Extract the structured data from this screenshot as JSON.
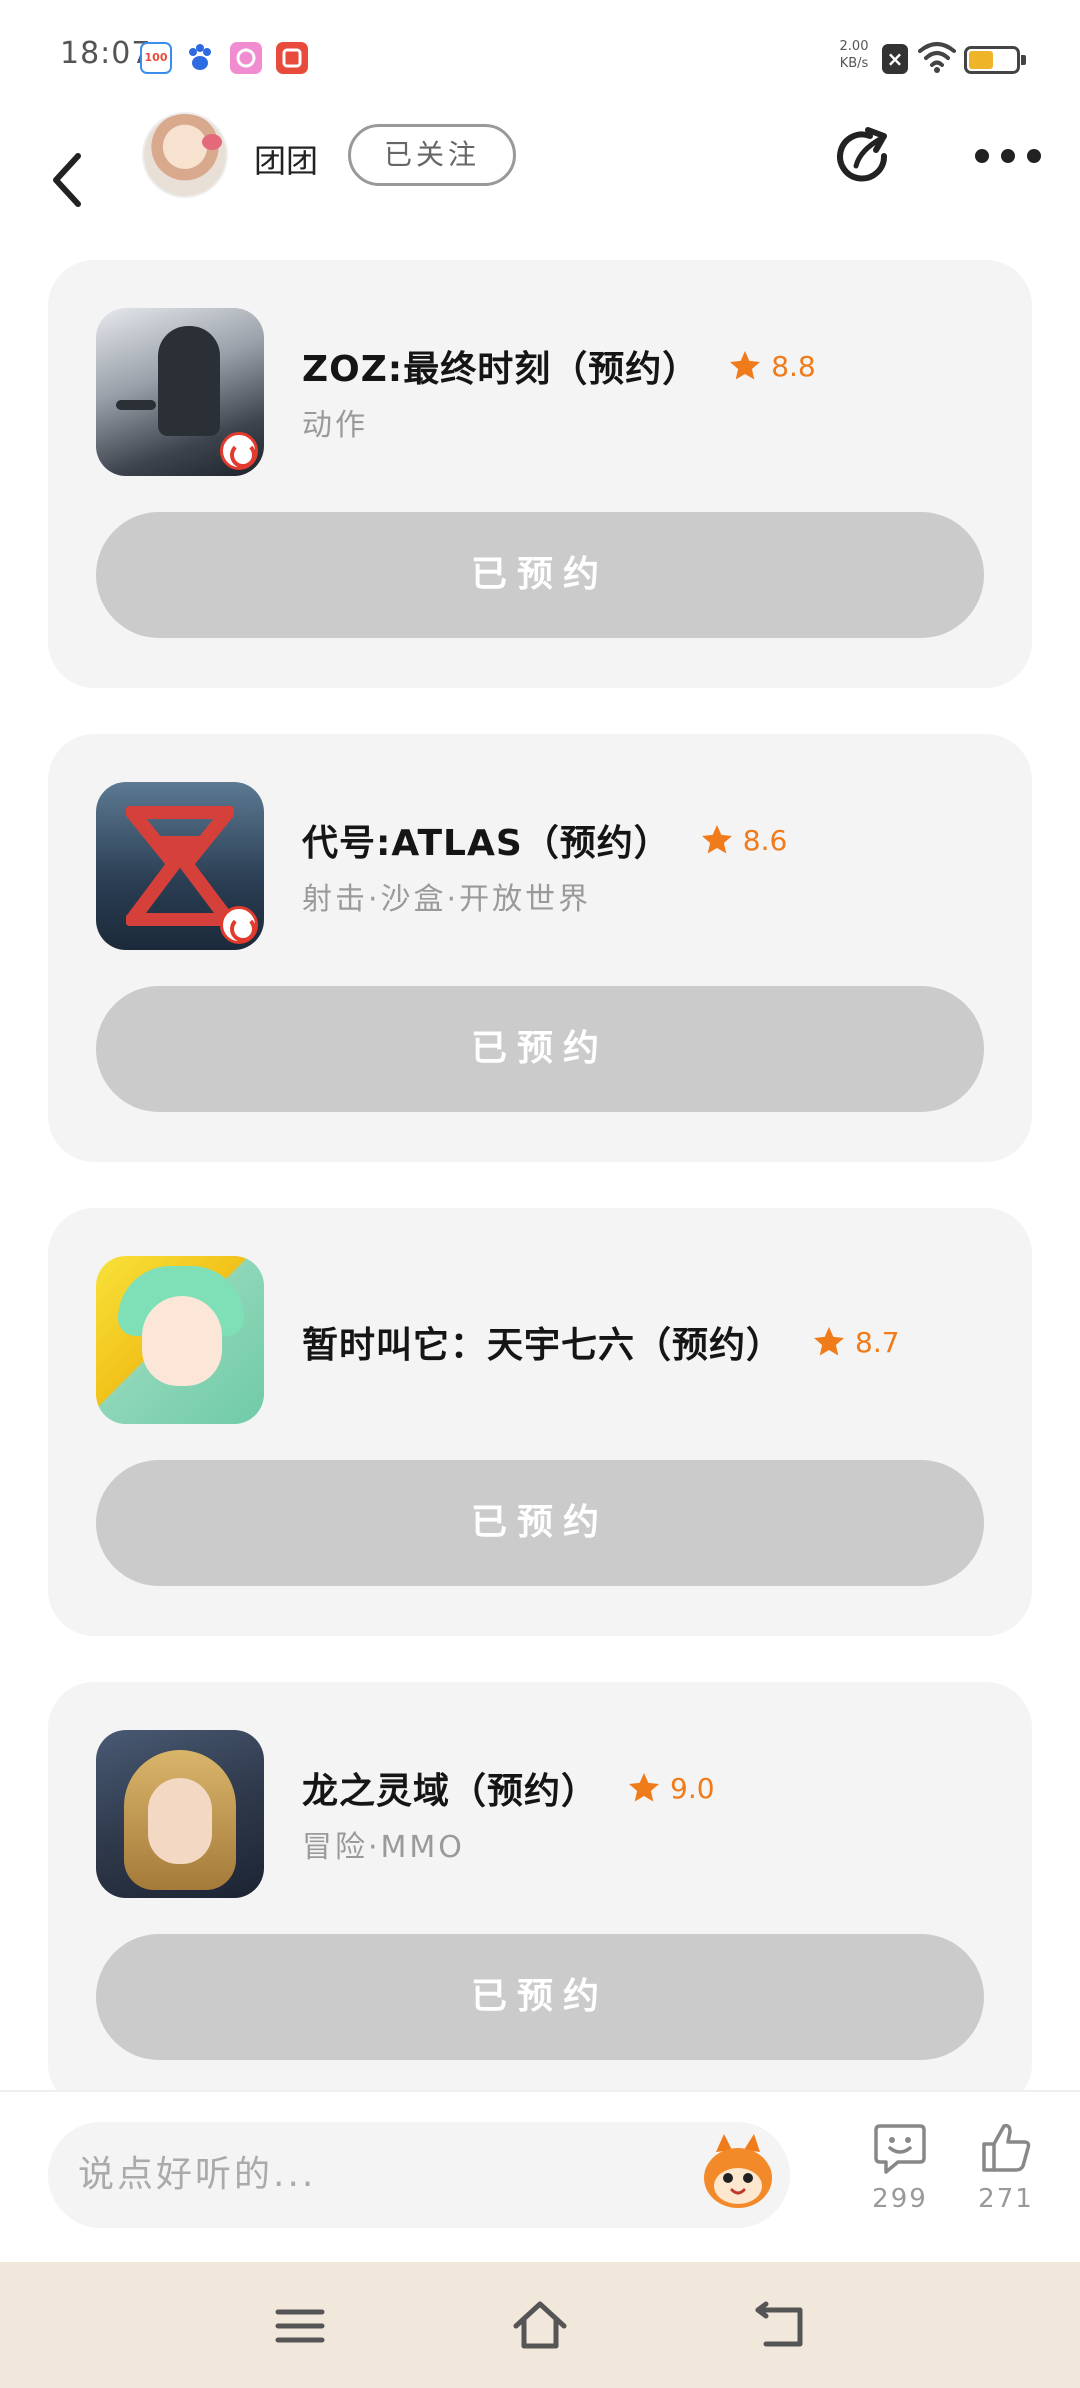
{
  "status_bar": {
    "time": "18:07",
    "net_speed_value": "2.00",
    "net_speed_unit": "KB/s",
    "app_icons": [
      {
        "name": "app-100-icon",
        "color": "#3a8ef0",
        "label": "100"
      },
      {
        "name": "baidu-paw-icon",
        "color": "#2f6be0",
        "label": ""
      },
      {
        "name": "app-pink-icon",
        "color": "#f08ccf",
        "label": ""
      },
      {
        "name": "app-red-icon",
        "color": "#e84a3c",
        "label": ""
      }
    ],
    "battery_level": 0.5
  },
  "header": {
    "username": "团团",
    "follow_label": "已关注"
  },
  "games": [
    {
      "title": "ZOZ:最终时刻（预约）",
      "rating": "8.8",
      "tags": "动作",
      "button": "已预约"
    },
    {
      "title": "代号:ATLAS（预约）",
      "rating": "8.6",
      "tags": "射击·沙盒·开放世界",
      "button": "已预约"
    },
    {
      "title": "暂时叫它：天宇七六（预约）",
      "rating": "8.7",
      "tags": "",
      "button": "已预约"
    },
    {
      "title": "龙之灵域（预约）",
      "rating": "9.0",
      "tags": "冒险·MMO",
      "button": "已预约"
    }
  ],
  "comment_bar": {
    "placeholder": "说点好听的...",
    "comment_count": "299",
    "like_count": "271"
  },
  "colors": {
    "accent_orange": "#f07b1a",
    "card_bg": "#f4f4f4",
    "button_disabled": "#cbcbcb",
    "nav_bg": "#f1e7da"
  }
}
